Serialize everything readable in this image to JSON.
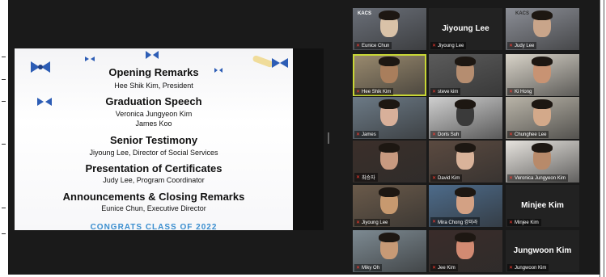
{
  "slide": {
    "sections": [
      {
        "title": "Opening Remarks",
        "subs": [
          "Hee Shik Kim, President"
        ]
      },
      {
        "title": "Graduation Speech",
        "subs": [
          "Veronica Jungyeon Kim",
          "James Koo"
        ]
      },
      {
        "title": "Senior Testimony",
        "subs": [
          "Jiyoung Lee, Director of Social Services"
        ]
      },
      {
        "title": "Presentation of Certificates",
        "subs": [
          "Judy Lee, Program Coordinator"
        ]
      },
      {
        "title": "Announcements & Closing Remarks",
        "subs": [
          "Eunice Chun, Executive Director"
        ]
      }
    ],
    "footer": "CONGRATS CLASS OF 2022",
    "accent_color": "#3a8ecf"
  },
  "gallery": {
    "participants": [
      {
        "name": "Eunice Chun",
        "video": true,
        "logo": "KACS"
      },
      {
        "name": "Jiyoung Lee",
        "video": false
      },
      {
        "name": "Judy Lee",
        "video": true,
        "logo": "KACS"
      },
      {
        "name": "Hee Shik Kim",
        "video": true,
        "active": true
      },
      {
        "name": "steve kim",
        "video": true
      },
      {
        "name": "Ki Hong",
        "video": true
      },
      {
        "name": "James",
        "video": true
      },
      {
        "name": "Doris Suh",
        "video": true
      },
      {
        "name": "Chunghee Lee",
        "video": true
      },
      {
        "name": "최승자",
        "video": true
      },
      {
        "name": "David Kim",
        "video": true
      },
      {
        "name": "Veronica Jungyeon Kim",
        "video": true
      },
      {
        "name": "Jiyoung Lee",
        "video": true
      },
      {
        "name": "Mira Chong 강미라",
        "video": true
      },
      {
        "name": "Minjee Kim",
        "video": false
      },
      {
        "name": "Miky Oh",
        "video": true
      },
      {
        "name": "Jee Kim",
        "video": true
      },
      {
        "name": "Jungwoon Kim",
        "video": false
      }
    ]
  },
  "colors": {
    "active_speaker": "#c8d635",
    "muted_mic": "#ff3b30",
    "background": "#1a1a1a"
  },
  "icons": [
    "muted-mic-icon",
    "bow-decoration-icon",
    "diploma-scroll-icon"
  ]
}
